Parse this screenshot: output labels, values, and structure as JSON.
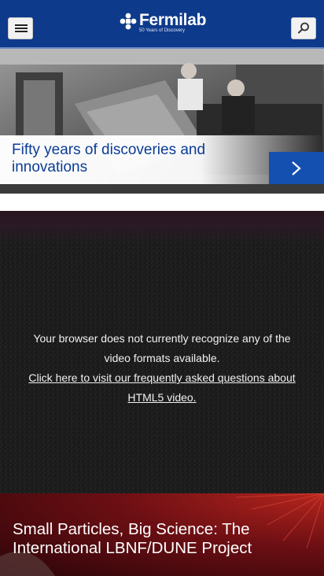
{
  "header": {
    "brand_name": "Fermilab",
    "brand_tagline": "50 Years of Discovery",
    "menu_icon": "hamburger-menu-icon",
    "search_icon": "search-icon",
    "background_color": "#0e3a8c"
  },
  "hero": {
    "title": "Fifty years of discoveries and innovations",
    "next_icon": "chevron-right-icon",
    "accent_color": "#1450b0",
    "title_color": "#0b3c96"
  },
  "video": {
    "message": "Your browser does not currently recognize any of the video formats available.",
    "faq_link": "Click here to visit our frequently asked questions about HTML5 video."
  },
  "banner": {
    "title": "Small Particles, Big Science: The International LBNF/DUNE Project"
  }
}
